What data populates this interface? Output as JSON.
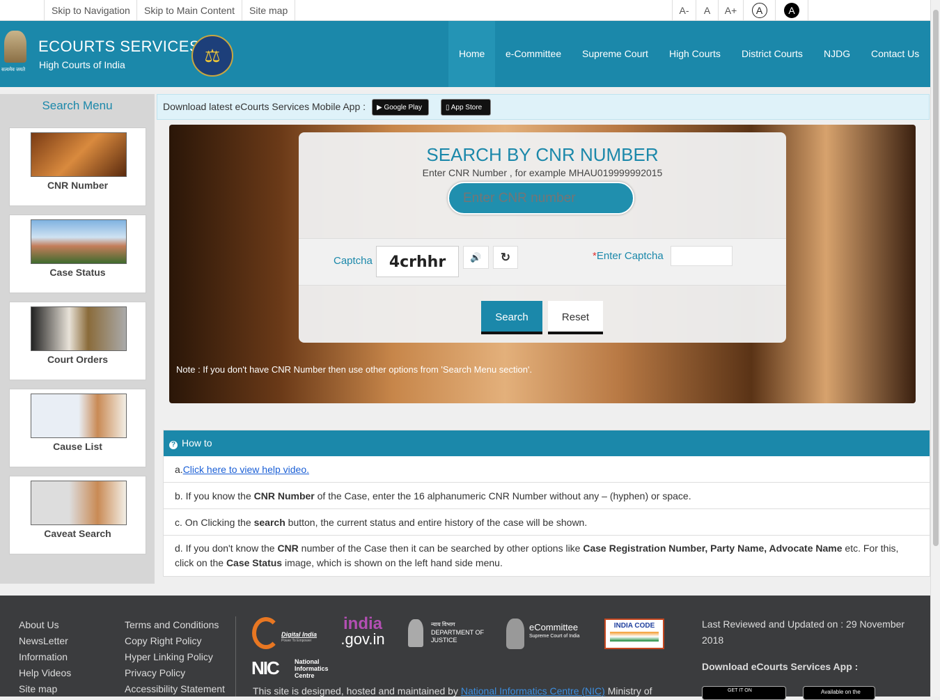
{
  "topbar": {
    "skip_nav": "Skip to Navigation",
    "skip_main": "Skip to Main Content",
    "site_map": "Site map",
    "font_decrease": "A-",
    "font_normal": "A",
    "font_increase": "A+",
    "contrast_normal": "A",
    "contrast_high": "A"
  },
  "header": {
    "title": "ECOURTS SERVICES",
    "subtitle": "High Courts of India",
    "emblem_text": "सत्यमेव जयते",
    "nav": [
      "Home",
      "e-Committee",
      "Supreme Court",
      "High Courts",
      "District Courts",
      "NJDG",
      "Contact Us"
    ],
    "color": "#1b88aa"
  },
  "sidebar": {
    "title": "Search Menu",
    "items": [
      {
        "label": "CNR Number"
      },
      {
        "label": "Case Status"
      },
      {
        "label": "Court Orders"
      },
      {
        "label": "Cause List"
      },
      {
        "label": "Caveat Search"
      }
    ]
  },
  "banner": {
    "text": "Download latest eCourts Services Mobile App :",
    "google_play": "Google Play",
    "google_play_top": "GET IT ON",
    "app_store": "App Store",
    "app_store_top": "Available on the"
  },
  "form": {
    "title": "SEARCH BY CNR NUMBER",
    "hint": "Enter CNR Number , for example MHAU019999992015",
    "cnr_placeholder": "Enter CNR number",
    "captcha_label": "Captcha",
    "captcha_text": "4crhhr",
    "enter_captcha_label": "Enter Captcha",
    "required_mark": "*",
    "search": "Search",
    "reset": "Reset",
    "note": "Note : If you don't have CNR Number then use other options from 'Search Menu section'."
  },
  "howto": {
    "title": "How to",
    "a_prefix": "a.",
    "a_link": "Click here to view help video.",
    "b": [
      "b. If you know the ",
      "CNR Number",
      " of the Case, enter the 16 alphanumeric CNR Number without any – (hyphen) or space."
    ],
    "c": [
      "c. On Clicking the ",
      "search",
      " button, the current status and entire history of the case will be shown."
    ],
    "d": [
      "d. If you don't know the ",
      "CNR",
      " number of the Case then it can be searched by other options like ",
      "Case Registration Number, Party Name, Advocate Name",
      " etc. For this, click on the ",
      "Case Status",
      " image, which is shown on the left hand side menu."
    ]
  },
  "footer": {
    "col1": [
      "About Us",
      "NewsLetter",
      "Information",
      "Help Videos",
      "Site map"
    ],
    "col2": [
      "Terms and Conditions",
      "Copy Right Policy",
      "Hyper Linking Policy",
      "Privacy Policy",
      "Accessibility Statement"
    ],
    "logos": {
      "digital_india": "Digital India",
      "digital_india_sub": "Power To Empower",
      "india_gov": "india",
      "india_gov2": ".gov.in",
      "doj": "DEPARTMENT OF JUSTICE",
      "doj_hindi": "न्याय विभाग",
      "ecommittee": "eCommittee",
      "ecommittee_sub": "Supreme Court of India",
      "india_code": "INDIA CODE",
      "nic": "NIC",
      "nic_full": "National Informatics Centre"
    },
    "designed_prefix": "This site is designed, hosted and maintained by ",
    "designed_link": "National Informatics Centre (NIC)",
    "designed_suffix": " Ministry of",
    "updated": "Last Reviewed and Updated on : 29 November 2018",
    "download_app": "Download eCourts Services App :",
    "get_it_on": "GET IT ON",
    "available_on": "Available on the"
  }
}
